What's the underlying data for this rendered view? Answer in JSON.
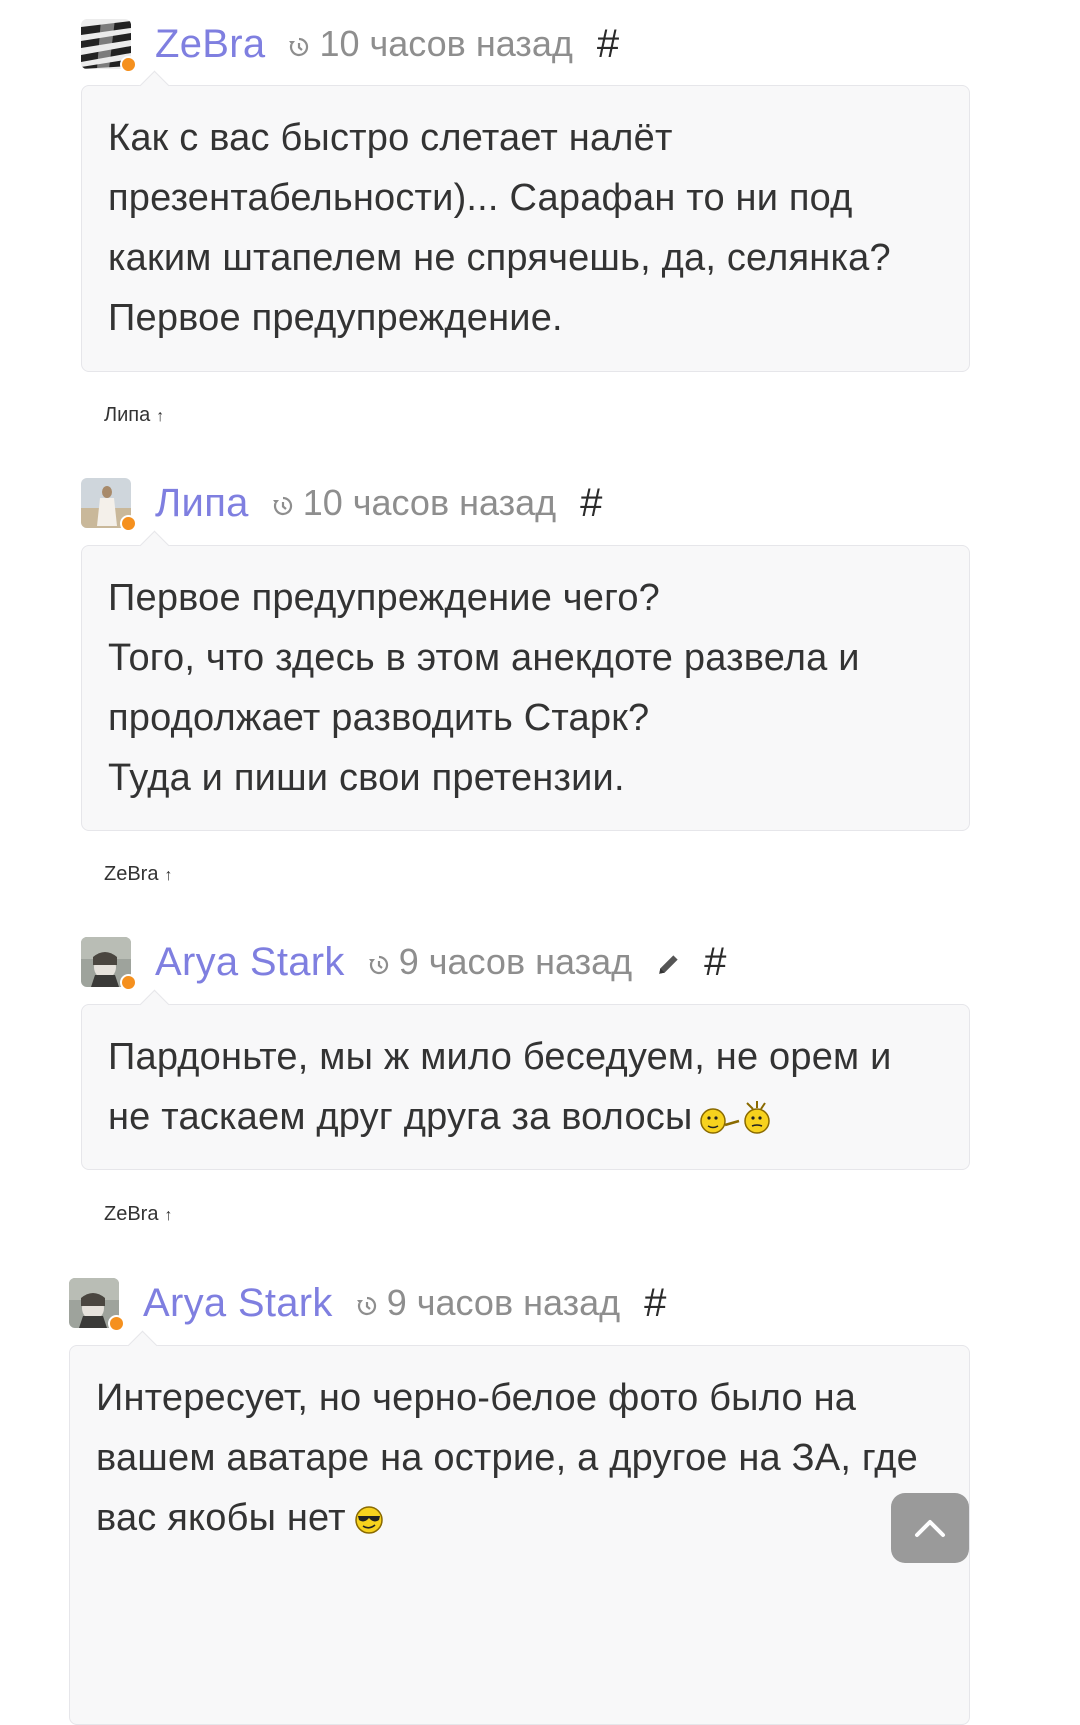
{
  "comments": [
    {
      "author": "ZeBra",
      "time": "10 часов назад",
      "hash": "#",
      "edited": false,
      "lines": [
        "Как с вас быстро слетает налёт",
        "презентабельности)... Сарафан то ни под",
        "каким штапелем не спрячешь, да, селянка?",
        "Первое предупреждение."
      ],
      "reply_to": "Липа",
      "reply_arrow": "↑",
      "avatar": "zebra-avatar"
    },
    {
      "author": "Липа",
      "time": "10 часов назад",
      "hash": "#",
      "edited": false,
      "lines": [
        "Первое предупреждение чего?",
        "Того, что здесь в этом анекдоте развела и",
        "продолжает разводить Старк?",
        "Туда и пиши свои претензии."
      ],
      "reply_to": "ZeBra",
      "reply_arrow": "↑",
      "avatar": "lipa-avatar"
    },
    {
      "author": "Arya Stark",
      "time": "9 часов назад",
      "hash": "#",
      "edited": true,
      "lines": [
        "Пардоньте, мы ж мило беседуем, не орем и",
        "не таскаем друг друга за волосы"
      ],
      "emoji": "fighting-smileys",
      "reply_to": "ZeBra",
      "reply_arrow": "↑",
      "avatar": "arya-avatar"
    },
    {
      "author": "Arya Stark",
      "time": "9 часов назад",
      "hash": "#",
      "edited": false,
      "lines": [
        "Интересует, но черно-белое фото было на",
        "вашем аватаре на острие, а другое на ЗА, где",
        "вас якобы нет"
      ],
      "emoji": "cool-sunglasses-smiley",
      "avatar": "arya-avatar"
    }
  ],
  "colors": {
    "author": "#7f7fe0",
    "time": "#8e8e8e",
    "status_dot": "#f5901e",
    "bubble_bg": "#f8f8f9",
    "bubble_border": "#e6e6ea"
  },
  "scroll_top_icon": "chevron-up-icon"
}
